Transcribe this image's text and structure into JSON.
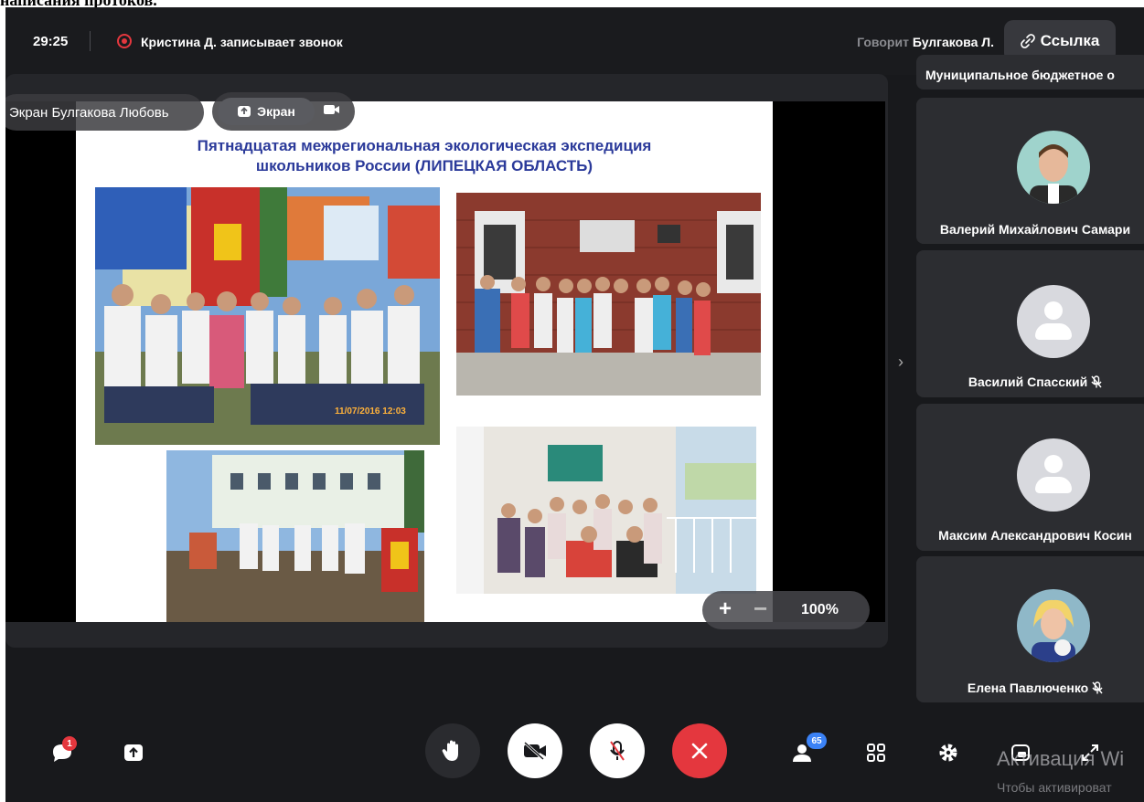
{
  "header": {
    "timer": "29:25",
    "recording_text": "Кристина Д. записывает звонок",
    "speaking_prefix": "Говорит",
    "speaking_name": "Булгакова Л.",
    "link_label": "Ссылка"
  },
  "screen_share": {
    "owner_label": "Экран Булгакова Любовь",
    "screen_button_label": "Экран",
    "slide_title_line1": "Пятнадцатая  межрегиональная экологическая экспедиция",
    "slide_title_line2": "школьников России (ЛИПЕЦКАЯ ОБЛАСТЬ)",
    "photo_date_stamp": "11/07/2016 12:03",
    "zoom_plus": "+",
    "zoom_minus": "−",
    "zoom_level": "100%"
  },
  "participants": [
    {
      "name": "Муниципальное бюджетное о",
      "muted": false
    },
    {
      "name": "Валерий Михайлович Самари",
      "muted": false
    },
    {
      "name": "Василий Спасский",
      "muted": true
    },
    {
      "name": "Максим Александрович Косин",
      "muted": false
    },
    {
      "name": "Елена Павлюченко",
      "muted": true
    }
  ],
  "toolbar": {
    "chat_badge": "1",
    "participants_count": "65"
  },
  "watermark": {
    "line1": "Активация Wi",
    "line2": "Чтобы активироват"
  },
  "colors": {
    "background": "#18191c",
    "tile": "#2c2d31",
    "hangup": "#e4373e",
    "slide_title": "#2b3a9a",
    "badge": "#3b82f6"
  }
}
